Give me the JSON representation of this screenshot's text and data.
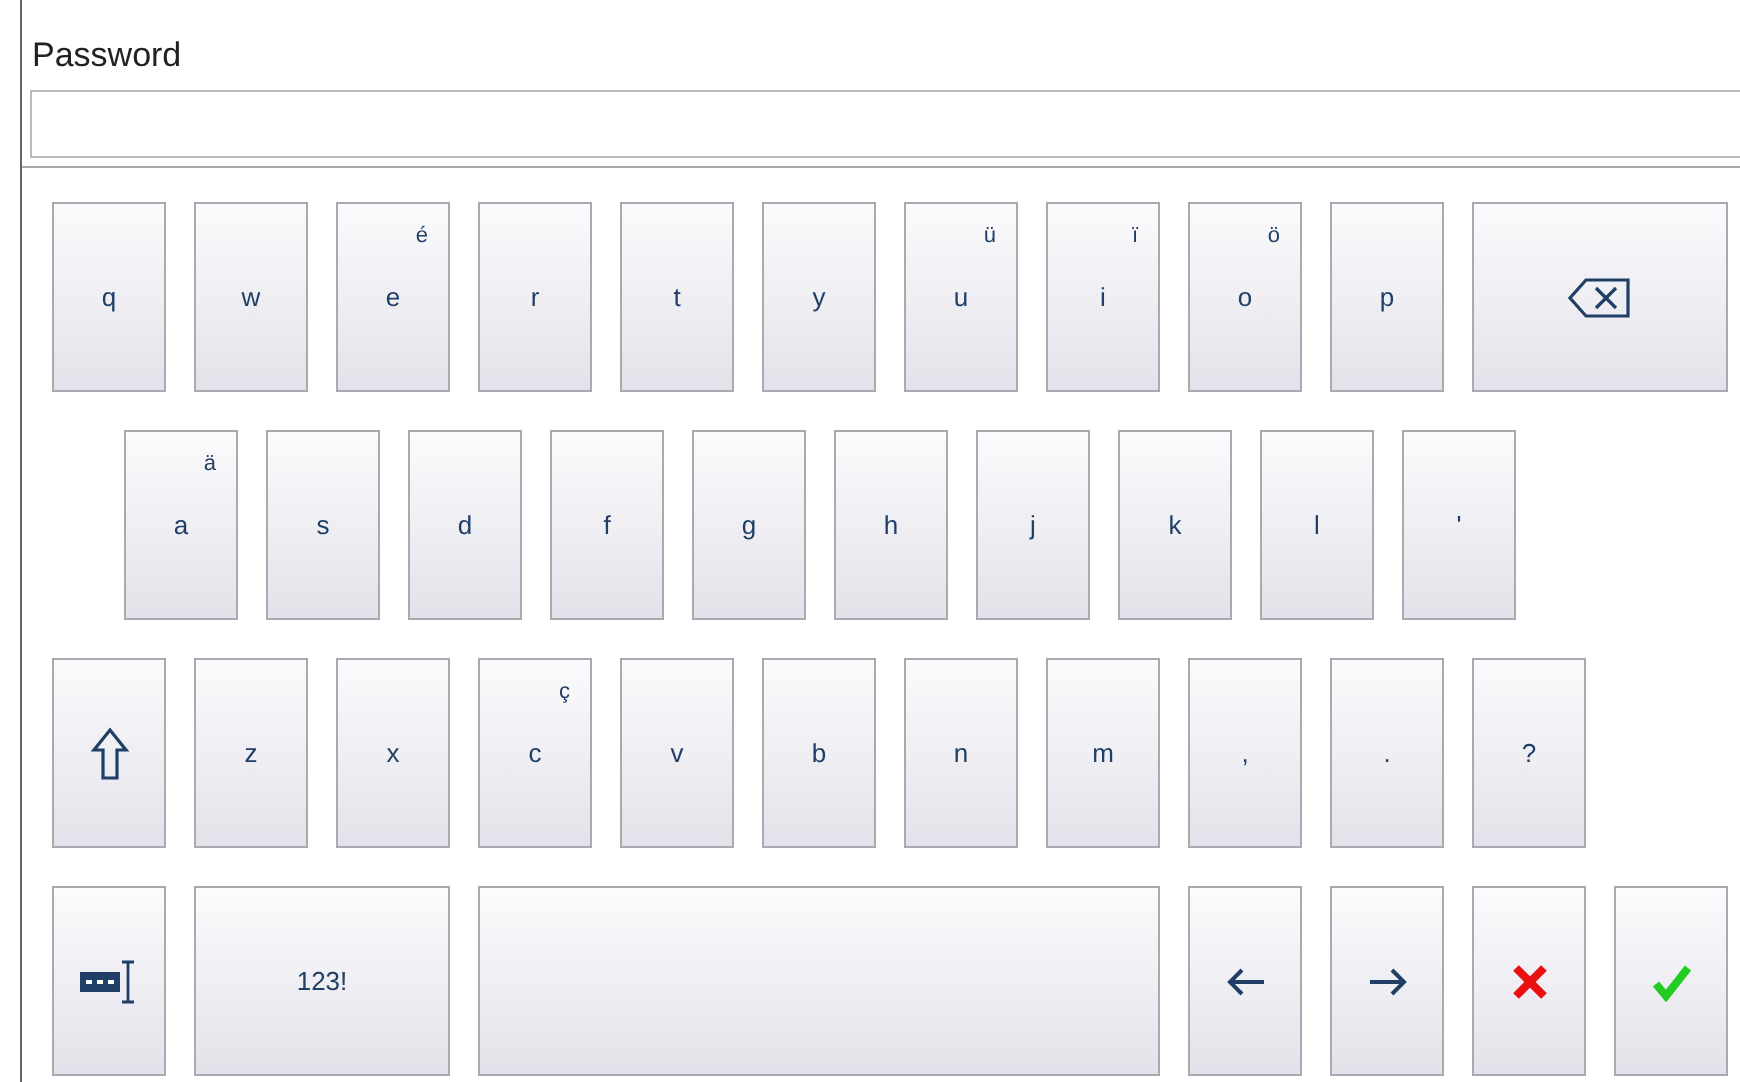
{
  "password_field": {
    "label": "Password"
  },
  "keyboard": {
    "rows": [
      {
        "indent": false,
        "keys": [
          {
            "kind": "char",
            "label": "q"
          },
          {
            "kind": "char",
            "label": "w"
          },
          {
            "kind": "char",
            "label": "e",
            "accent": "é"
          },
          {
            "kind": "char",
            "label": "r"
          },
          {
            "kind": "char",
            "label": "t"
          },
          {
            "kind": "char",
            "label": "y"
          },
          {
            "kind": "char",
            "label": "u",
            "accent": "ü"
          },
          {
            "kind": "char",
            "label": "i",
            "accent": "ï"
          },
          {
            "kind": "char",
            "label": "o",
            "accent": "ö"
          },
          {
            "kind": "char",
            "label": "p"
          },
          {
            "kind": "backspace"
          }
        ]
      },
      {
        "indent": true,
        "keys": [
          {
            "kind": "char",
            "label": "a",
            "accent": "ä"
          },
          {
            "kind": "char",
            "label": "s"
          },
          {
            "kind": "char",
            "label": "d"
          },
          {
            "kind": "char",
            "label": "f"
          },
          {
            "kind": "char",
            "label": "g"
          },
          {
            "kind": "char",
            "label": "h"
          },
          {
            "kind": "char",
            "label": "j"
          },
          {
            "kind": "char",
            "label": "k"
          },
          {
            "kind": "char",
            "label": "l"
          },
          {
            "kind": "char",
            "label": "'"
          }
        ]
      },
      {
        "indent": false,
        "keys": [
          {
            "kind": "shift"
          },
          {
            "kind": "char",
            "label": "z"
          },
          {
            "kind": "char",
            "label": "x"
          },
          {
            "kind": "char",
            "label": "c",
            "accent": "ç"
          },
          {
            "kind": "char",
            "label": "v"
          },
          {
            "kind": "char",
            "label": "b"
          },
          {
            "kind": "char",
            "label": "n"
          },
          {
            "kind": "char",
            "label": "m"
          },
          {
            "kind": "char",
            "label": ","
          },
          {
            "kind": "char",
            "label": "."
          },
          {
            "kind": "char",
            "label": "?"
          }
        ]
      },
      {
        "indent": false,
        "keys": [
          {
            "kind": "layout"
          },
          {
            "kind": "wide",
            "label": "123!"
          },
          {
            "kind": "space"
          },
          {
            "kind": "left"
          },
          {
            "kind": "right"
          },
          {
            "kind": "cancel"
          },
          {
            "kind": "ok"
          }
        ]
      }
    ]
  }
}
